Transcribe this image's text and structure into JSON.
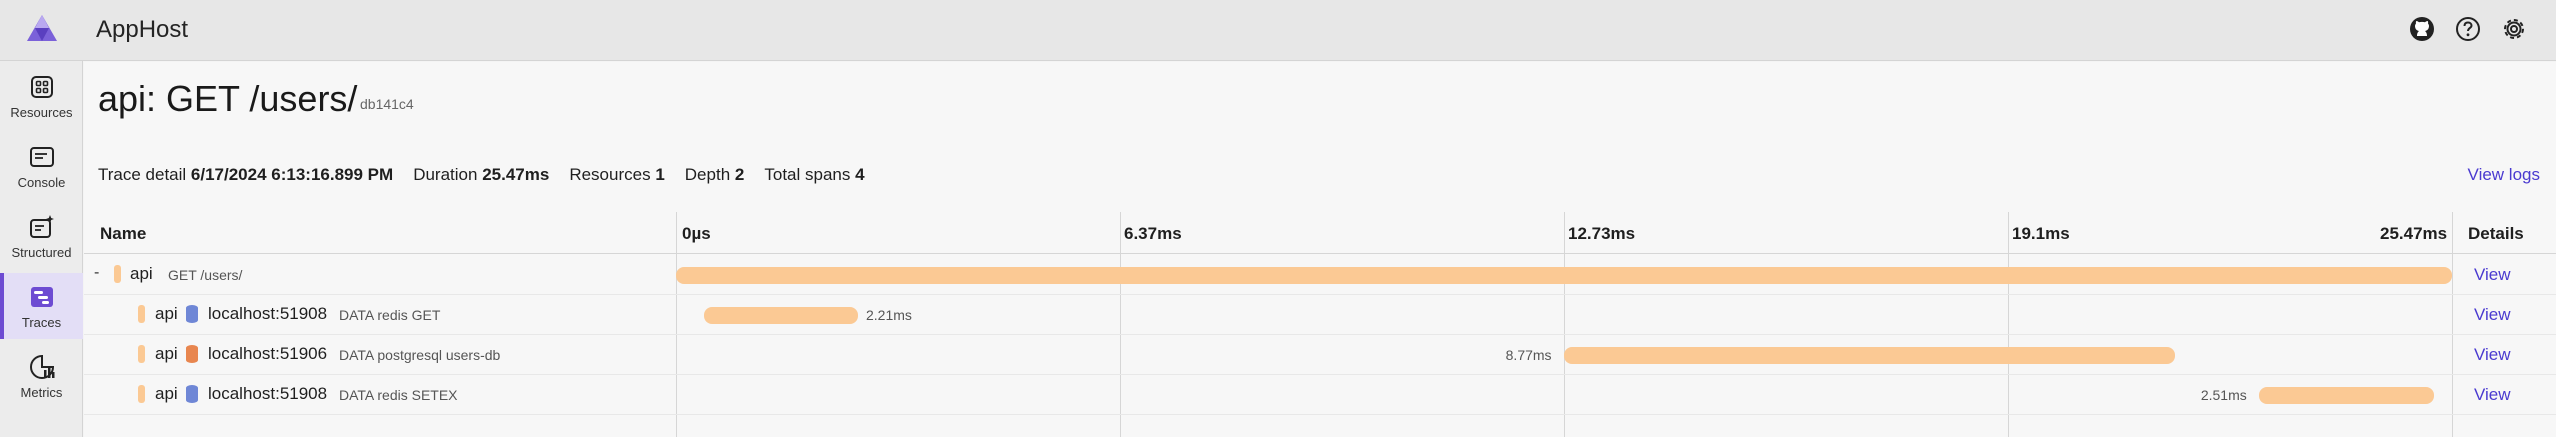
{
  "header": {
    "app_title": "AppHost",
    "icons": [
      "github-icon",
      "help-icon",
      "settings-icon"
    ]
  },
  "nav": {
    "items": [
      {
        "label": "Resources",
        "icon": "resources-icon"
      },
      {
        "label": "Console",
        "icon": "console-icon"
      },
      {
        "label": "Structured",
        "icon": "structured-logs-icon"
      },
      {
        "label": "Traces",
        "icon": "traces-icon",
        "active": true
      },
      {
        "label": "Metrics",
        "icon": "metrics-icon"
      }
    ]
  },
  "page": {
    "title": "api: GET /users/",
    "trace_id": "db141c4",
    "summary": {
      "trace_detail_label": "Trace detail",
      "trace_detail_value": "6/17/2024 6:13:16.899 PM",
      "duration_label": "Duration",
      "duration_value": "25.47ms",
      "resources_label": "Resources",
      "resources_value": "1",
      "depth_label": "Depth",
      "depth_value": "2",
      "total_spans_label": "Total spans",
      "total_spans_value": "4"
    },
    "view_logs": "View logs"
  },
  "grid": {
    "name_header": "Name",
    "details_header": "Details",
    "ticks": [
      "0µs",
      "6.37ms",
      "12.73ms",
      "19.1ms",
      "25.47ms"
    ],
    "total_ms": 25.47,
    "rows": [
      {
        "toggle": "-",
        "service": "api",
        "peer": "",
        "description": "GET /users/",
        "start_ms": 0,
        "duration_ms": 25.47,
        "duration_label": "",
        "view": "View",
        "db_color": ""
      },
      {
        "toggle": "",
        "service": "api",
        "peer": "localhost:51908",
        "description": "DATA redis GET",
        "start_ms": 0.4,
        "duration_ms": 2.21,
        "duration_label": "2.21ms",
        "view": "View",
        "db_color": "#6f87d6"
      },
      {
        "toggle": "",
        "service": "api",
        "peer": "localhost:51906",
        "description": "DATA postgresql users-db",
        "start_ms": 12.73,
        "duration_ms": 8.77,
        "duration_label": "8.77ms",
        "view": "View",
        "db_color": "#e8864f"
      },
      {
        "toggle": "",
        "service": "api",
        "peer": "localhost:51908",
        "description": "DATA redis SETEX",
        "start_ms": 22.7,
        "duration_ms": 2.51,
        "duration_label": "2.51ms",
        "view": "View",
        "db_color": "#6f87d6"
      }
    ]
  },
  "colors": {
    "accent": "#4a3ad0",
    "span_bar": "#fbc994",
    "resource_swatch": "#fbc994"
  }
}
